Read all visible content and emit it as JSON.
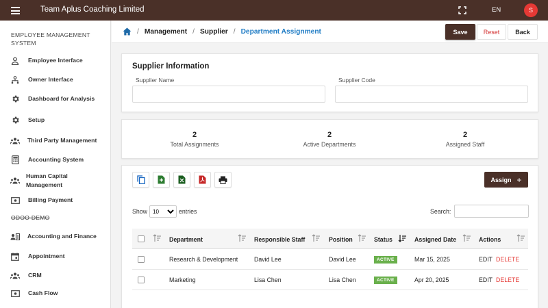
{
  "app": {
    "title": "Team Aplus Coaching Limited",
    "language": "EN",
    "avatar_initial": "S",
    "brand_color": "#4a3028"
  },
  "sidebar": {
    "section1": "EMPLOYEE MANAGEMENT SYSTEM",
    "items1": [
      {
        "label": "Employee Interface",
        "icon": "person-icon"
      },
      {
        "label": "Owner Interface",
        "icon": "hierarchy-icon"
      },
      {
        "label": "Dashboard for Analysis",
        "icon": "gear-icon"
      },
      {
        "label": "Setup",
        "icon": "gear-icon"
      },
      {
        "label": "Third Party Management",
        "icon": "group-icon"
      },
      {
        "label": "Accounting System",
        "icon": "calculator-icon"
      },
      {
        "label": "Human Capital Management",
        "icon": "group-icon"
      },
      {
        "label": "Billing Payment",
        "icon": "money-icon"
      }
    ],
    "section2": "ODOO DEMO",
    "items2": [
      {
        "label": "Accounting and Finance",
        "icon": "contact-card-icon"
      },
      {
        "label": "Appointment",
        "icon": "calendar-icon"
      },
      {
        "label": "CRM",
        "icon": "group-icon"
      },
      {
        "label": "Cash Flow",
        "icon": "money-icon"
      }
    ]
  },
  "breadcrumb": {
    "items": [
      "Management",
      "Supplier"
    ],
    "current": "Department Assignment"
  },
  "toolbar": {
    "save": "Save",
    "reset": "Reset",
    "back": "Back"
  },
  "supplier": {
    "title": "Supplier Information",
    "name_label": "Supplier Name",
    "name_value": "",
    "code_label": "Supplier Code",
    "code_value": ""
  },
  "stats": [
    {
      "value": "2",
      "label": "Total Assignments"
    },
    {
      "value": "2",
      "label": "Active Departments"
    },
    {
      "value": "2",
      "label": "Assigned Staff"
    }
  ],
  "table": {
    "assign_label": "Assign",
    "show_label": "Show",
    "entries_value": "10",
    "entries_label": "entries",
    "search_label": "Search:",
    "search_value": "",
    "columns": [
      "Department",
      "Responsible Staff",
      "Position",
      "Status",
      "Assigned Date",
      "Actions"
    ],
    "rows": [
      {
        "department": "Research & Development",
        "staff": "David Lee",
        "position": "David Lee",
        "status": "ACTIVE",
        "date": "Mar 15, 2025",
        "edit": "EDIT",
        "delete": "DELETE"
      },
      {
        "department": "Marketing",
        "staff": "Lisa Chen",
        "position": "Lisa Chen",
        "status": "ACTIVE",
        "date": "Apr 20, 2025",
        "edit": "EDIT",
        "delete": "DELETE"
      }
    ]
  }
}
